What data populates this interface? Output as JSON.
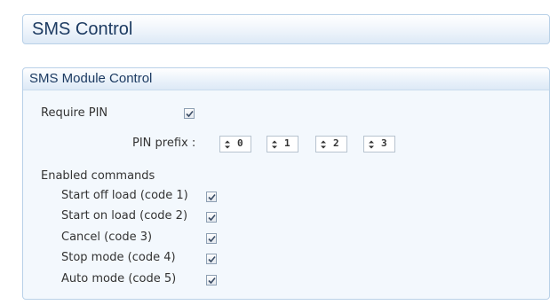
{
  "header": {
    "title": "SMS Control"
  },
  "panel": {
    "title": "SMS Module Control",
    "require_pin": {
      "label": "Require PIN",
      "checked": true
    },
    "pin_prefix": {
      "label": "PIN prefix :",
      "digits": [
        "0",
        "1",
        "2",
        "3"
      ]
    },
    "enabled_commands": {
      "label": "Enabled commands",
      "items": [
        {
          "label": "Start off load (code 1)",
          "checked": true
        },
        {
          "label": "Start on load (code 2)",
          "checked": true
        },
        {
          "label": "Cancel (code 3)",
          "checked": true
        },
        {
          "label": "Stop mode (code 4)",
          "checked": true
        },
        {
          "label": "Auto mode (code 5)",
          "checked": true
        }
      ]
    }
  }
}
